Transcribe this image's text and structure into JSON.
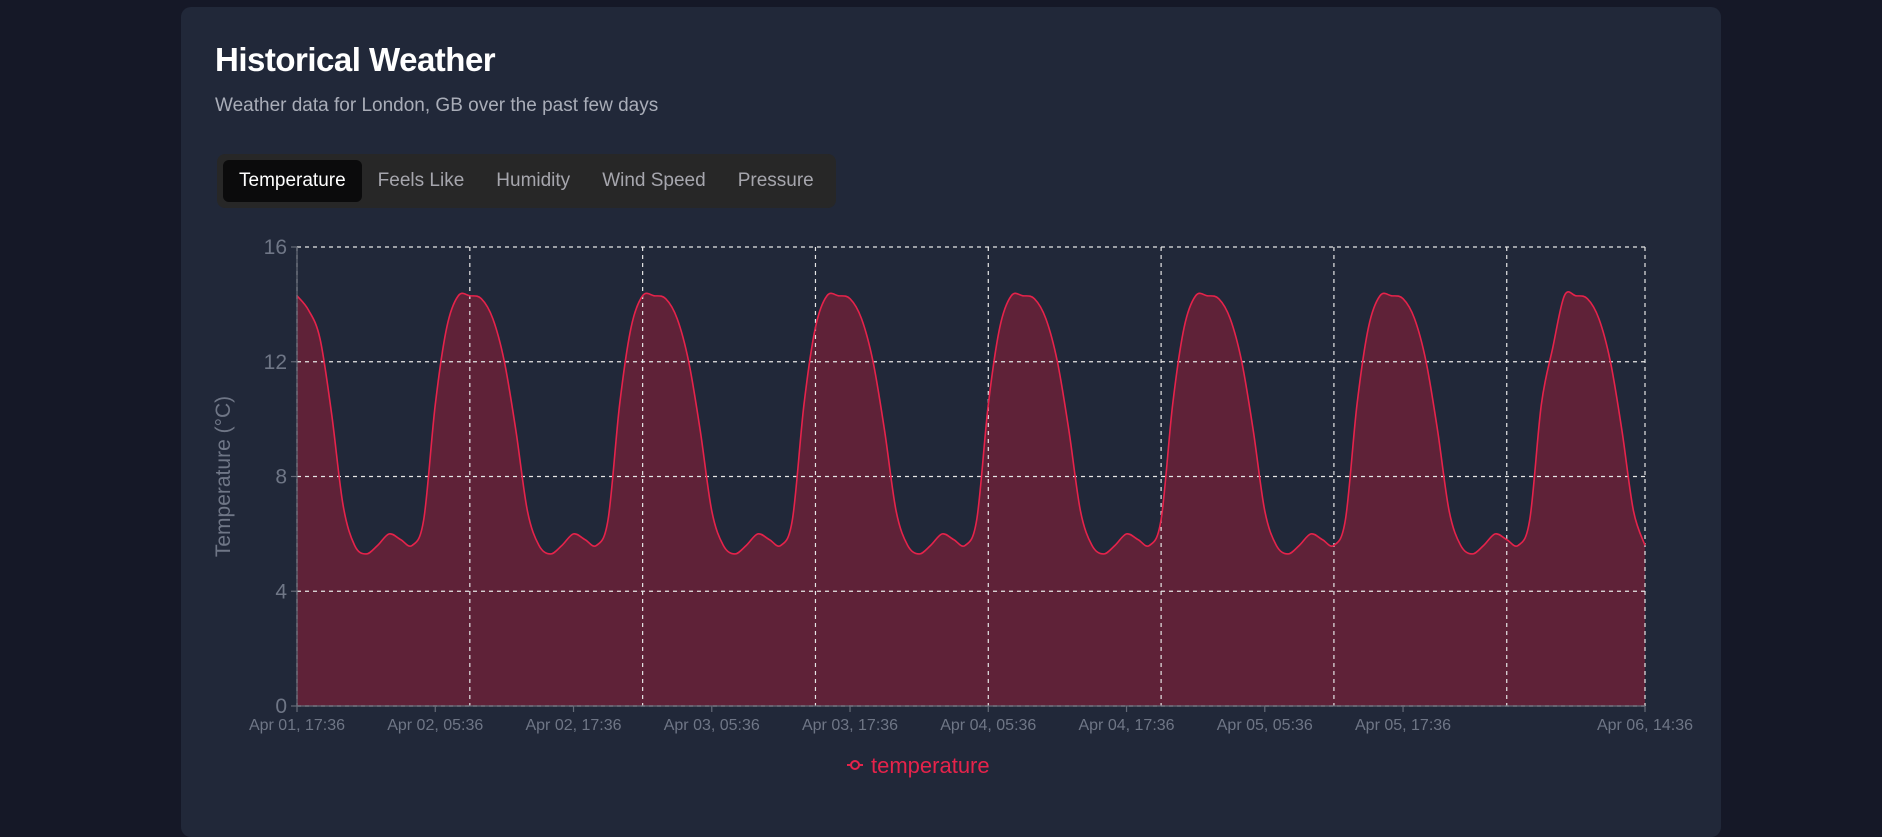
{
  "page": {
    "title": "Historical Weather",
    "subtitle": "Weather data for London, GB over the past few days"
  },
  "tabs": [
    {
      "label": "Temperature",
      "active": true
    },
    {
      "label": "Feels Like",
      "active": false
    },
    {
      "label": "Humidity",
      "active": false
    },
    {
      "label": "Wind Speed",
      "active": false
    },
    {
      "label": "Pressure",
      "active": false
    }
  ],
  "colors": {
    "series": "#e5234b",
    "fill": "#5f2238",
    "grid": "#e6e6e6",
    "axis_text": "#6f7686"
  },
  "chart_data": {
    "type": "area",
    "title": "",
    "ylabel": "Temperature (°C)",
    "xlabel": "",
    "ylim": [
      0,
      16
    ],
    "yticks": [
      0,
      4,
      8,
      12,
      16
    ],
    "grid": true,
    "legend_position": "bottom-center",
    "x_tick_labels": [
      "Apr 01, 17:36",
      "Apr 02, 05:36",
      "Apr 02, 17:36",
      "Apr 03, 05:36",
      "Apr 03, 17:36",
      "Apr 04, 05:36",
      "Apr 04, 17:36",
      "Apr 05, 05:36",
      "Apr 05, 17:36",
      "Apr 06, 14:36"
    ],
    "x_tick_hours": [
      0,
      12,
      24,
      36,
      48,
      60,
      72,
      84,
      96,
      117
    ],
    "x_grid_hours": [
      0,
      15,
      30,
      45,
      60,
      75,
      90,
      105,
      117
    ],
    "x_range_hours": [
      0,
      117
    ],
    "series": [
      {
        "name": "temperature",
        "x_hours": [
          0,
          1,
          2,
          3,
          4,
          5,
          6,
          7,
          8,
          9,
          10,
          11,
          12,
          13,
          14,
          15,
          16,
          17,
          18,
          19,
          20,
          21,
          22,
          23,
          24,
          25,
          26,
          27,
          28,
          29,
          30,
          31,
          32,
          33,
          34,
          35,
          36,
          37,
          38,
          39,
          40,
          41,
          42,
          43,
          44,
          45,
          46,
          47,
          48,
          49,
          50,
          51,
          52,
          53,
          54,
          55,
          56,
          57,
          58,
          59,
          60,
          61,
          62,
          63,
          64,
          65,
          66,
          67,
          68,
          69,
          70,
          71,
          72,
          73,
          74,
          75,
          76,
          77,
          78,
          79,
          80,
          81,
          82,
          83,
          84,
          85,
          86,
          87,
          88,
          89,
          90,
          91,
          92,
          93,
          94,
          95,
          96,
          97,
          98,
          99,
          100,
          101,
          102,
          103,
          104,
          105,
          106,
          107,
          108,
          109,
          110,
          111,
          112,
          113,
          114,
          115,
          116,
          117
        ],
        "values": [
          14.3,
          13.8,
          12.8,
          10.2,
          7.0,
          5.6,
          5.3,
          5.6,
          6.0,
          5.8,
          5.6,
          6.5,
          10.5,
          13.2,
          14.3,
          14.3,
          14.2,
          13.5,
          12.0,
          9.6,
          6.8,
          5.6,
          5.3,
          5.6,
          6.0,
          5.8,
          5.6,
          6.5,
          10.5,
          13.2,
          14.3,
          14.3,
          14.2,
          13.5,
          12.0,
          9.6,
          6.8,
          5.6,
          5.3,
          5.6,
          6.0,
          5.8,
          5.6,
          6.5,
          10.5,
          13.2,
          14.3,
          14.3,
          14.2,
          13.5,
          12.0,
          9.6,
          6.8,
          5.6,
          5.3,
          5.6,
          6.0,
          5.8,
          5.6,
          6.5,
          10.5,
          13.2,
          14.3,
          14.3,
          14.2,
          13.5,
          12.0,
          9.6,
          6.8,
          5.6,
          5.3,
          5.6,
          6.0,
          5.8,
          5.6,
          6.5,
          10.5,
          13.2,
          14.3,
          14.3,
          14.2,
          13.5,
          12.0,
          9.6,
          6.8,
          5.6,
          5.3,
          5.6,
          6.0,
          5.8,
          5.6,
          6.5,
          10.5,
          13.2,
          14.3,
          14.3,
          14.2,
          13.5,
          12.0,
          9.6,
          6.8,
          5.6,
          5.3,
          5.6,
          6.0,
          5.8,
          5.6,
          6.5,
          10.5,
          12.5,
          14.3,
          14.3,
          14.2,
          13.5,
          12.0,
          9.6,
          6.8,
          5.6
        ]
      }
    ]
  }
}
